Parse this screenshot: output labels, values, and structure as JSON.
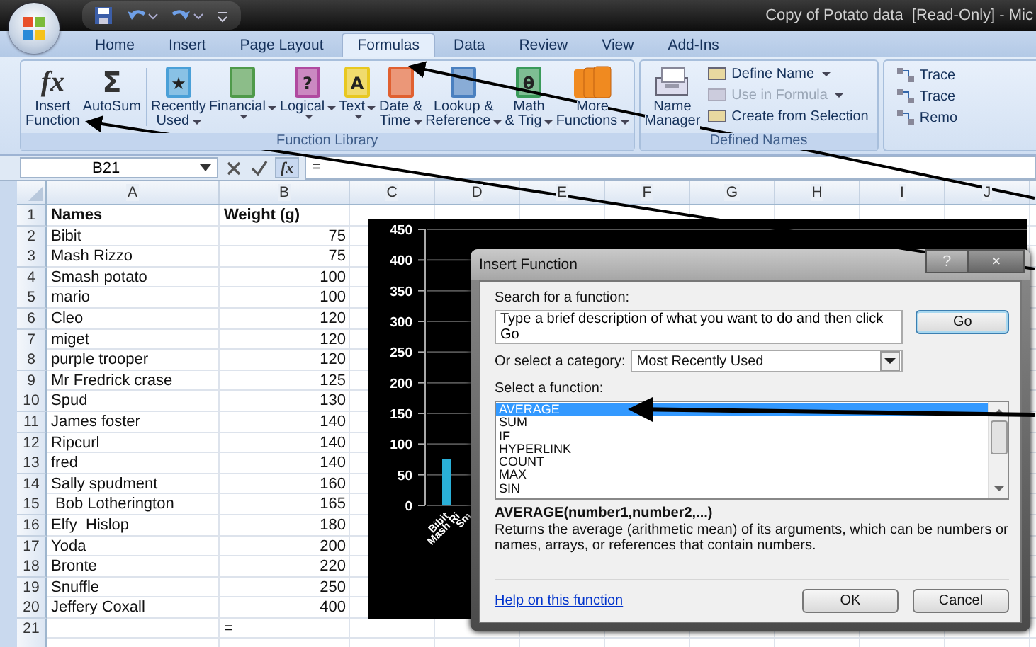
{
  "window": {
    "title": "Copy of Potato data  [Read-Only] - Mic"
  },
  "tabs": [
    {
      "label": "Home",
      "selected": false
    },
    {
      "label": "Insert",
      "selected": false
    },
    {
      "label": "Page Layout",
      "selected": false
    },
    {
      "label": "Formulas",
      "selected": true
    },
    {
      "label": "Data",
      "selected": false
    },
    {
      "label": "Review",
      "selected": false
    },
    {
      "label": "View",
      "selected": false
    },
    {
      "label": "Add-Ins",
      "selected": false
    }
  ],
  "ribbon": {
    "function_library": {
      "label": "Function Library",
      "buttons": [
        {
          "kind": "fx",
          "glyph": "fx",
          "label": [
            "Insert",
            "Function"
          ],
          "dropdown": false
        },
        {
          "kind": "sigma",
          "glyph": "Σ",
          "label": [
            "AutoSum"
          ],
          "dropdown": false
        },
        {
          "kind": "book",
          "color": "#4aa0d8",
          "glyph": "★",
          "label": [
            "Recently",
            "Used"
          ],
          "dropdown": true
        },
        {
          "kind": "book",
          "color": "#4f9a4a",
          "label": [
            "Financial"
          ],
          "dropdown": true
        },
        {
          "kind": "book",
          "color": "#b04aa0",
          "glyph": "?",
          "label": [
            "Logical"
          ],
          "dropdown": true
        },
        {
          "kind": "book",
          "color": "#e8c820",
          "glyph": "A",
          "label": [
            "Text"
          ],
          "dropdown": true
        },
        {
          "kind": "book",
          "color": "#e06030",
          "label": [
            "Date &",
            "Time"
          ],
          "dropdown": true
        },
        {
          "kind": "book",
          "color": "#4a80c0",
          "label": [
            "Lookup &",
            "Reference"
          ],
          "dropdown": true
        },
        {
          "kind": "book",
          "color": "#3a9a5a",
          "glyph": "θ",
          "label": [
            "Math",
            "& Trig"
          ],
          "dropdown": true
        },
        {
          "kind": "books",
          "color": "#f08a20",
          "label": [
            "More",
            "Functions"
          ],
          "dropdown": true
        }
      ]
    },
    "defined_names": {
      "label": "Defined Names",
      "name_manager": [
        "Name",
        "Manager"
      ],
      "commands": [
        {
          "label": "Define Name",
          "dropdown": true,
          "disabled": false
        },
        {
          "label": "Use in Formula",
          "dropdown": true,
          "disabled": true
        },
        {
          "label": "Create from Selection",
          "dropdown": false,
          "disabled": false
        }
      ]
    },
    "formula_auditing": {
      "commands": [
        "Trace",
        "Trace",
        "Remo"
      ]
    }
  },
  "formula_bar": {
    "name_box": "B21",
    "function_button": "fx",
    "formula": "="
  },
  "sheet": {
    "columns": [
      "A",
      "B",
      "C",
      "D",
      "E",
      "F",
      "G",
      "H",
      "I",
      "J"
    ],
    "rows": [
      {
        "number": "1",
        "kind": "header",
        "a": "Names",
        "b": "Weight (g)"
      },
      {
        "number": "2",
        "kind": "value",
        "a": "Bibit",
        "b": "75"
      },
      {
        "number": "3",
        "kind": "value",
        "a": "Mash Rizzo",
        "b": "75"
      },
      {
        "number": "4",
        "kind": "value",
        "a": "Smash potato",
        "b": "100"
      },
      {
        "number": "5",
        "kind": "value",
        "a": "mario",
        "b": "100"
      },
      {
        "number": "6",
        "kind": "value",
        "a": "Cleo",
        "b": "120"
      },
      {
        "number": "7",
        "kind": "value",
        "a": "miget",
        "b": "120"
      },
      {
        "number": "8",
        "kind": "value",
        "a": "purple trooper",
        "b": "120"
      },
      {
        "number": "9",
        "kind": "value",
        "a": "Mr Fredrick crase",
        "b": "125"
      },
      {
        "number": "10",
        "kind": "value",
        "a": "Spud",
        "b": "130"
      },
      {
        "number": "11",
        "kind": "value",
        "a": "James foster",
        "b": "140"
      },
      {
        "number": "12",
        "kind": "value",
        "a": "Ripcurl",
        "b": "140"
      },
      {
        "number": "13",
        "kind": "value",
        "a": "fred",
        "b": "140"
      },
      {
        "number": "14",
        "kind": "value",
        "a": "Sally spudment",
        "b": "160"
      },
      {
        "number": "15",
        "kind": "value",
        "a": " Bob Lotherington",
        "b": "165"
      },
      {
        "number": "16",
        "kind": "value",
        "a": "Elfy  Hislop",
        "b": "180"
      },
      {
        "number": "17",
        "kind": "value",
        "a": "Yoda",
        "b": "200"
      },
      {
        "number": "18",
        "kind": "value",
        "a": "Bronte",
        "b": "220"
      },
      {
        "number": "19",
        "kind": "value",
        "a": "Snuffle",
        "b": "250"
      },
      {
        "number": "20",
        "kind": "value",
        "a": "Jeffery Coxall",
        "b": "400"
      },
      {
        "number": "21",
        "kind": "edit",
        "b": "="
      }
    ],
    "chart": {
      "chart_data": {
        "type": "bar",
        "grid": true,
        "categories": [
          "Bibit",
          "Mash Ri",
          "Sm"
        ],
        "values": [
          75,
          null,
          null
        ],
        "ylim": [
          0,
          450
        ],
        "yticks": [
          0,
          50,
          100,
          150,
          200,
          250,
          300,
          350,
          400,
          450
        ]
      }
    }
  },
  "dialog": {
    "title": "Insert Function",
    "help_button": "?",
    "close_button": "×",
    "search_label": "Search for a function:",
    "search_value": "Type a brief description of what you want to do and then click Go",
    "go_button": "Go",
    "category_label": "Or select a category:",
    "category_value": "Most Recently Used",
    "function_label": "Select a function:",
    "functions": [
      {
        "name": "AVERAGE",
        "selected": true
      },
      {
        "name": "SUM",
        "selected": false
      },
      {
        "name": "IF",
        "selected": false
      },
      {
        "name": "HYPERLINK",
        "selected": false
      },
      {
        "name": "COUNT",
        "selected": false
      },
      {
        "name": "MAX",
        "selected": false
      },
      {
        "name": "SIN",
        "selected": false
      }
    ],
    "signature": "AVERAGE(number1,number2,...)",
    "description": "Returns the average (arithmetic mean) of its arguments, which can be numbers or names, arrays, or references that contain numbers.",
    "help_link": "Help on this function",
    "ok_button": "OK",
    "cancel_button": "Cancel"
  }
}
